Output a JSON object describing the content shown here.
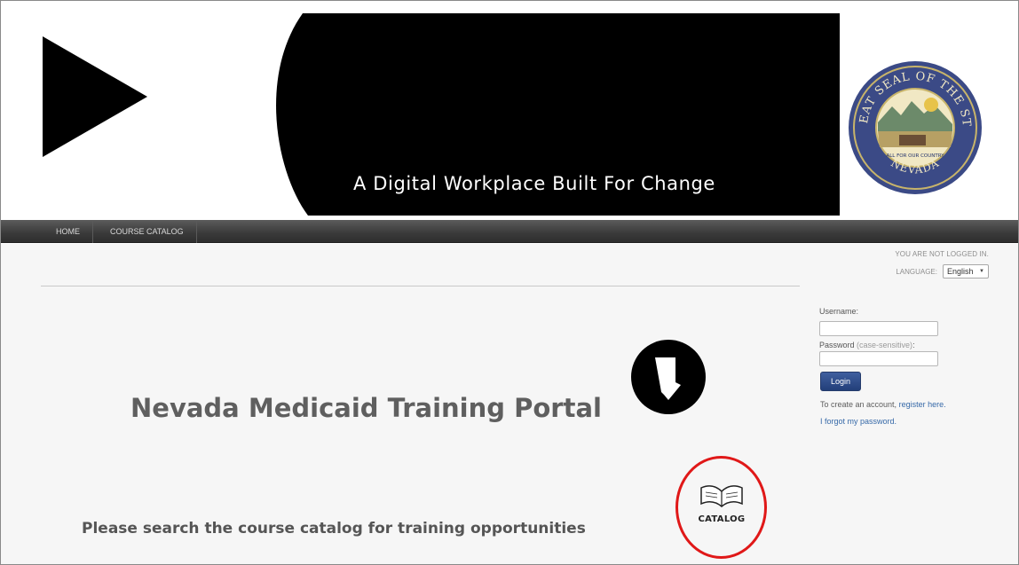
{
  "header": {
    "banner_text": "A Digital Workplace Built For Change",
    "seal": {
      "top_text": "THE GREAT SEAL OF THE STATE OF",
      "bottom_text": "NEVADA",
      "motto": "ALL FOR OUR COUNTRY"
    }
  },
  "nav": {
    "items": [
      {
        "label": "HOME"
      },
      {
        "label": "COURSE CATALOG"
      }
    ]
  },
  "user_menu": {
    "status": "YOU ARE NOT LOGGED IN.",
    "language_label": "LANGUAGE:",
    "language_value": "English"
  },
  "main": {
    "title": "Nevada Medicaid Training Portal",
    "catalog_note": "Please search the course catalog for training opportunities",
    "catalog_label": "CATALOG"
  },
  "login": {
    "username_label": "Username:",
    "username_value": "",
    "password_label": "Password",
    "password_hint": "(case-sensitive)",
    "password_suffix": ":",
    "password_value": "",
    "button_label": "Login",
    "create_text": "To create an account,",
    "register_link": "register here.",
    "forgot_link": "I forgot my password."
  },
  "icons": {
    "play": "play-icon",
    "seal": "state-seal-icon",
    "nevada": "nevada-state-icon",
    "catalog": "open-book-icon"
  },
  "colors": {
    "banner_bg": "#000000",
    "nav_bg": "#3a3a3a",
    "login_button": "#2d4a86",
    "link": "#3669a8",
    "highlight_circle": "#e01818"
  }
}
